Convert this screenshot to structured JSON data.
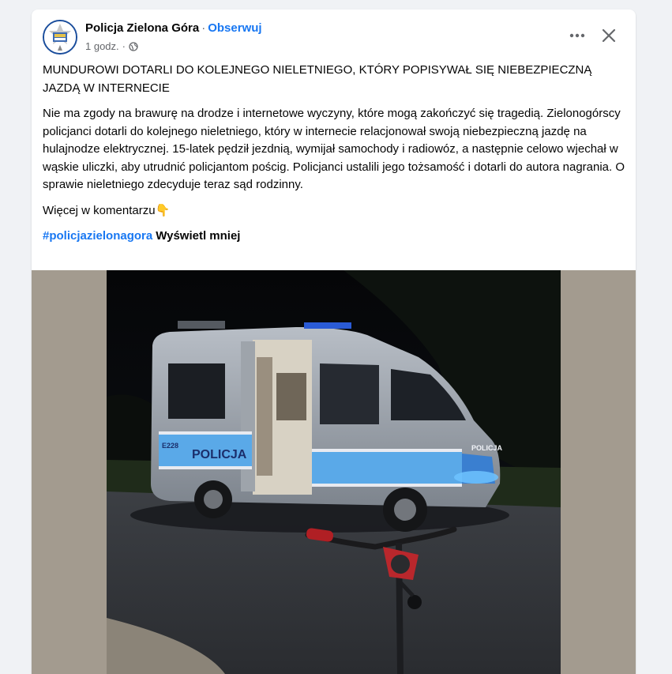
{
  "post": {
    "page_name": "Policja Zielona Góra",
    "separator": "·",
    "follow_label": "Obserwuj",
    "time": "1 godz.",
    "time_separator": "·",
    "audience_icon": "globe-icon",
    "headline": "MUNDUROWI DOTARLI DO KOLEJNEGO NIELETNIEGO, KTÓRY POPISYWAŁ SIĘ NIEBEZPIECZNĄ JAZDĄ W INTERNECIE",
    "body": "Nie ma zgody na brawurę na drodze i internetowe wyczyny, które mogą zakończyć się tragedią. Zielonogórscy policjanci dotarli do kolejnego nieletniego, który w internecie relacjonował swoją niebezpieczną jazdę na hulajnodze elektrycznej. 15-latek pędził jezdnią, wymijał samochody i radiowóz, a następnie celowo wjechał w wąskie uliczki, aby utrudnić policjantom pościg. Policjanci ustalili jego tożsamość i dotarli do autora nagrania. O sprawie nieletniego zdecyduje teraz sąd rodzinny.",
    "more_in_comments": "Więcej w komentarzu👇",
    "hashtag": "#policjazielonagora",
    "show_less": "Wyświetl mniej"
  },
  "photo": {
    "van_side_text": "POLICJA",
    "van_hood_text": "POLICJA",
    "van_number": "E228"
  },
  "colors": {
    "link": "#1877f2",
    "secondary_text": "#65676b",
    "background": "#f0f2f5",
    "media_backdrop": "#a39b8f"
  }
}
